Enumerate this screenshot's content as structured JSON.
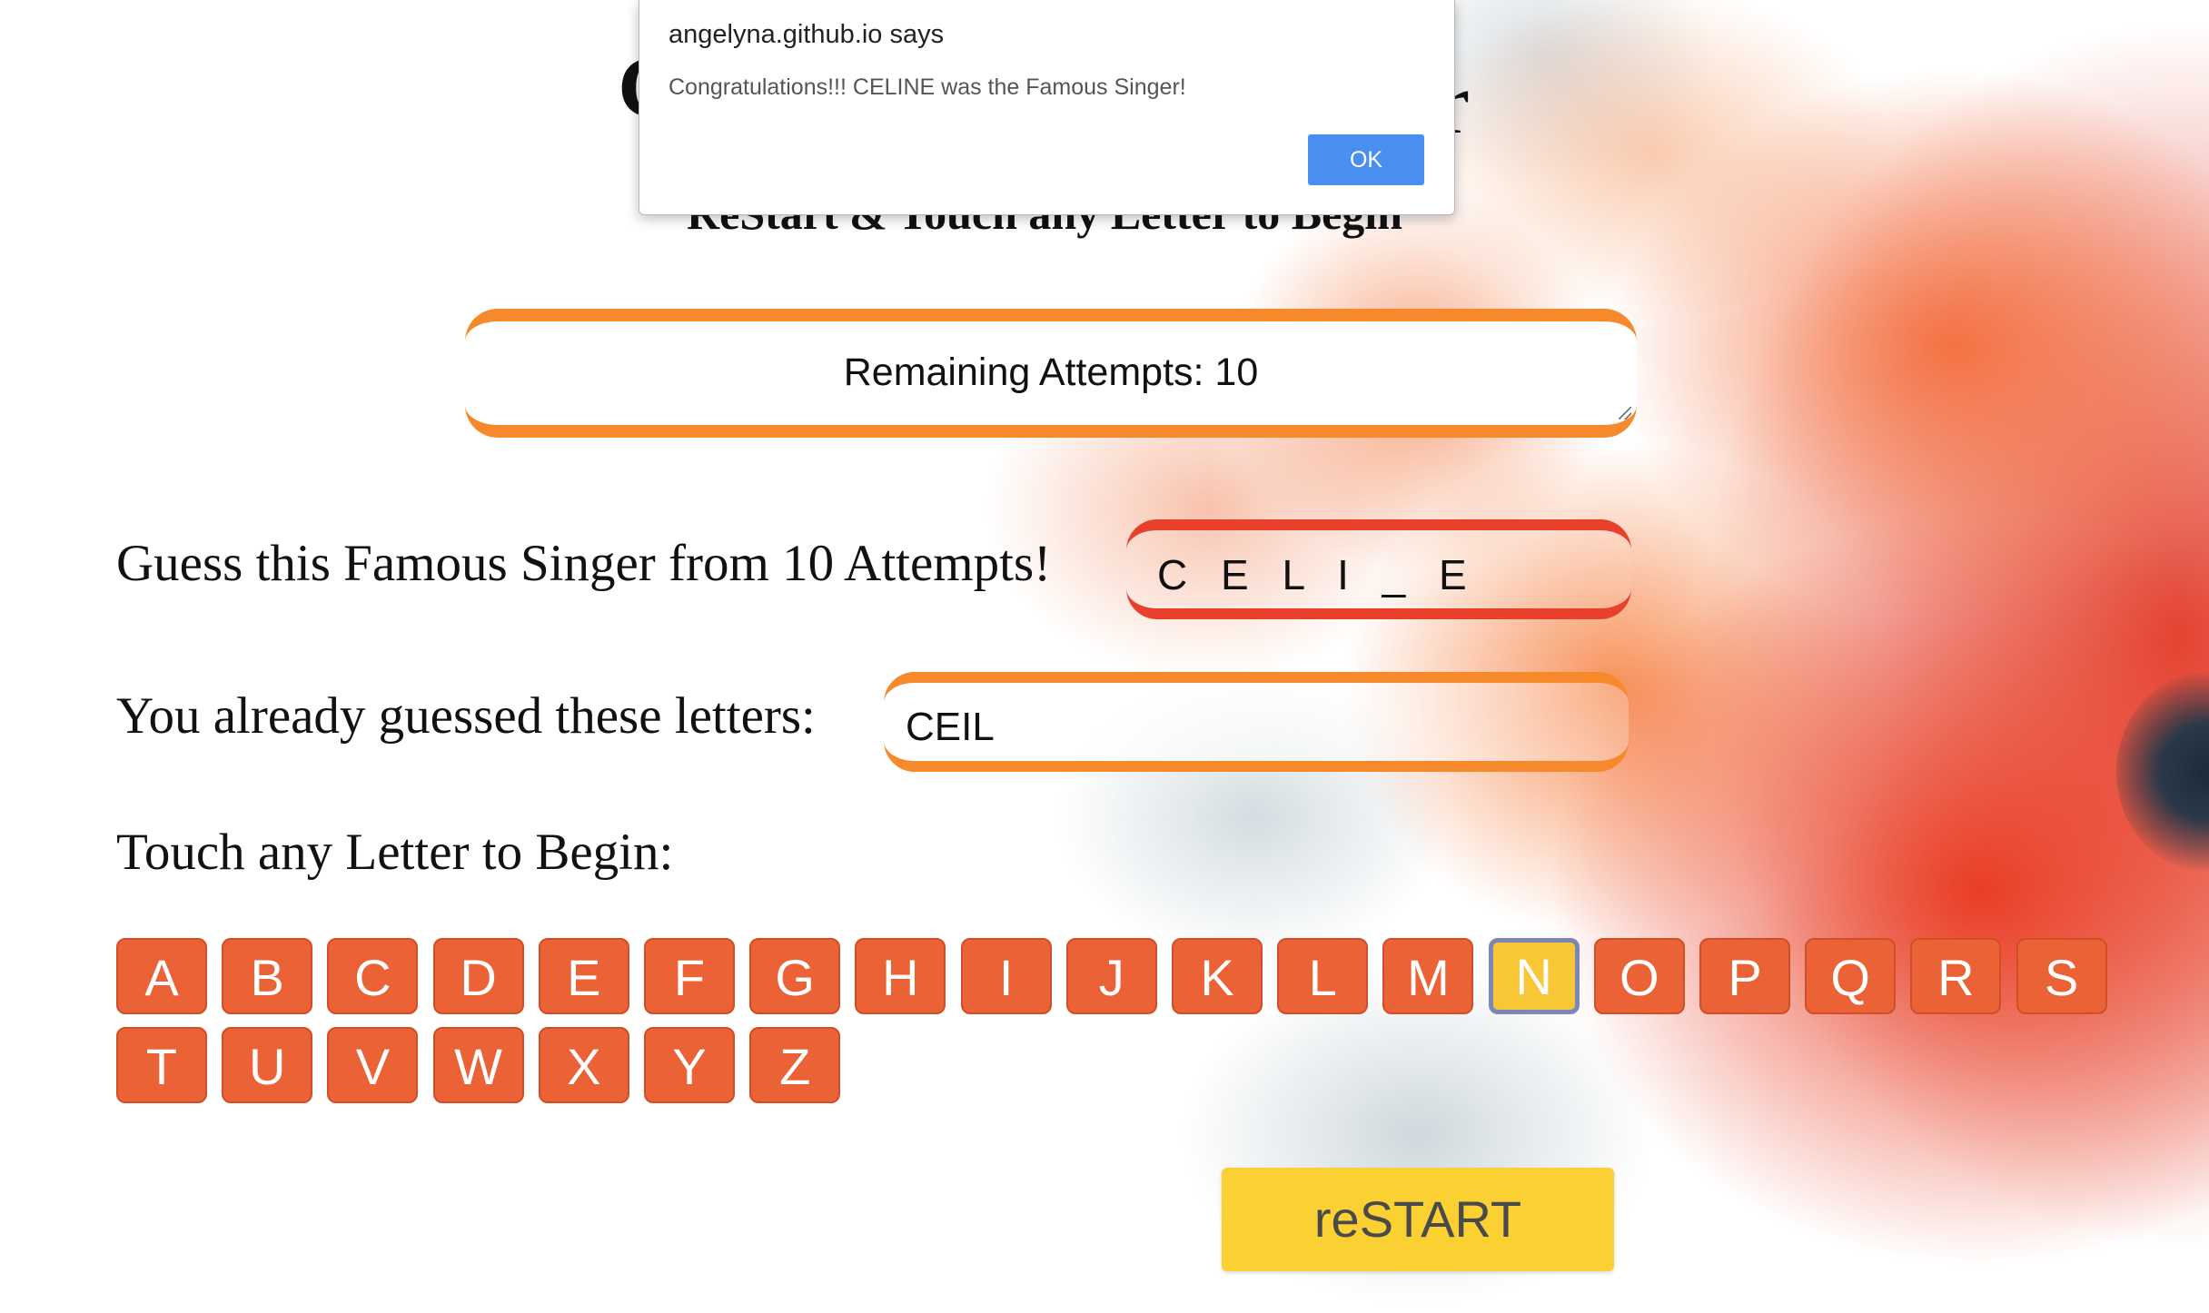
{
  "page": {
    "title_left": "G",
    "title_right": "r",
    "subtitle": "ReStart & Touch any Letter to Begin"
  },
  "game": {
    "remaining_attempts": "Remaining Attempts: 10",
    "guess_prompt": "Guess this Famous Singer from 10 Attempts!",
    "word_display": "C E L I _ E",
    "guessed_prompt": "You already guessed these letters:",
    "guessed_letters": "CEIL",
    "touch_prompt": "Touch any Letter to Begin:",
    "restart_label": "reSTART",
    "selected_letter": "N"
  },
  "keyboard": {
    "letters": [
      "A",
      "B",
      "C",
      "D",
      "E",
      "F",
      "G",
      "H",
      "I",
      "J",
      "K",
      "L",
      "M",
      "N",
      "O",
      "P",
      "Q",
      "R",
      "S",
      "T",
      "U",
      "V",
      "W",
      "X",
      "Y",
      "Z"
    ]
  },
  "dialog": {
    "origin": "angelyna.github.io says",
    "message": "Congratulations!!! CELINE was the Famous Singer!",
    "ok_label": "OK"
  },
  "colors": {
    "key_orange": "#ea6235",
    "key_selected": "#f7c735",
    "restart_yellow": "#fbd033",
    "box_orange": "#f6892b",
    "box_red": "#e8402a",
    "dialog_button": "#4a8ef0"
  }
}
